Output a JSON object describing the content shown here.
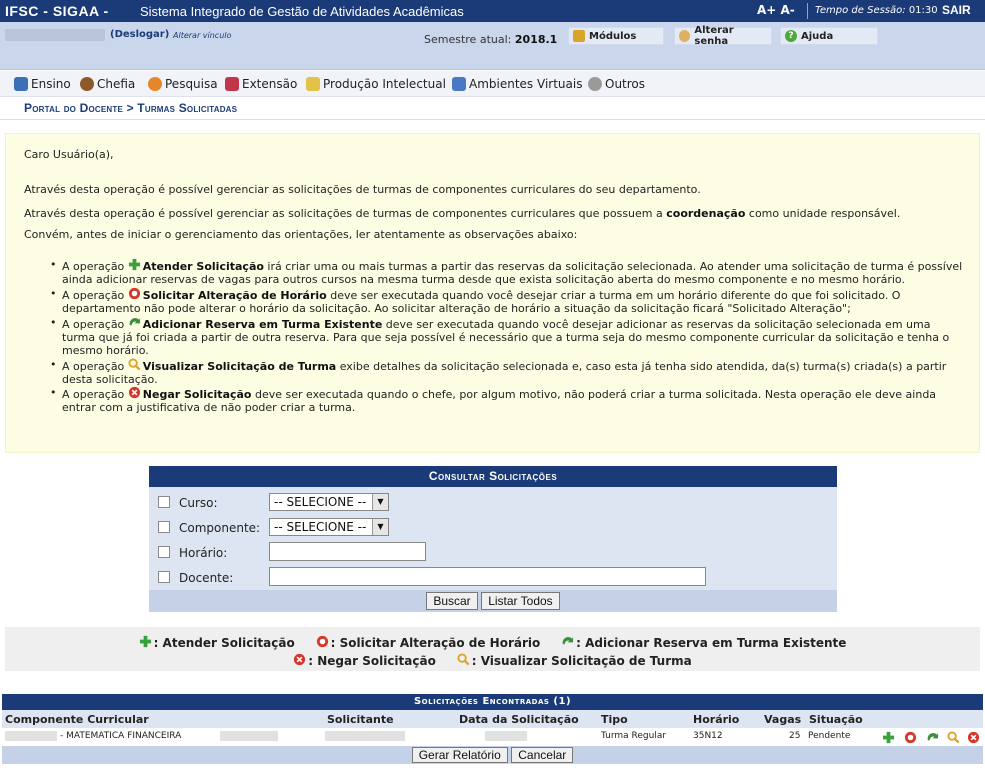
{
  "topbar": {
    "brand": "IFSC - SIGAA -",
    "subtitle": "Sistema Integrado de Gestão de Atividades Acadêmicas",
    "font_controls": "A+ A-",
    "session_label": "Tempo de Sessão:",
    "session_time": "01:30",
    "logout": "SAIR"
  },
  "infobar": {
    "deslogar": "(Deslogar)",
    "alterar_vinculo": "Alterar vínculo",
    "semestre_label": "Semestre atual:",
    "semestre_value": "2018.1",
    "modulos": "Módulos",
    "alterar_senha": "Alterar senha",
    "ajuda": "Ajuda"
  },
  "menu": [
    "Ensino",
    "Chefia",
    "Pesquisa",
    "Extensão",
    "Produção Intelectual",
    "Ambientes Virtuais",
    "Outros"
  ],
  "breadcrumb": "Portal do Docente > Turmas Solicitadas",
  "instructions": {
    "greeting": "Caro Usuário(a),",
    "p1": "Através desta operação é possível gerenciar as solicitações de turmas de componentes curriculares do seu departamento.",
    "p2_pre": "Através desta operação é possível gerenciar as solicitações de turmas de componentes curriculares que possuem a ",
    "p2_bold": "coordenação",
    "p2_post": " como unidade responsável.",
    "p3": "Convém, antes de iniciar o gerenciamento das orientações, ler atentamente as observações abaixo:",
    "items": [
      {
        "pre": "A operação ",
        "op": "Atender Solicitação",
        "text": " irá criar uma ou mais turmas a partir das reservas da solicitação selecionada. Ao atender uma solicitação de turma é possível ainda adicionar reservas de vagas para outros cursos na mesma turma desde que exista solicitação aberta do mesmo componente e no mesmo horário."
      },
      {
        "pre": "A operação ",
        "op": "Solicitar Alteração de Horário",
        "text": " deve ser executada quando você desejar criar a turma em um horário diferente do que foi solicitado. O departamento não pode alterar o horário da solicitação. Ao solicitar alteração de horário a situação da solicitação ficará \"Solicitado Alteração\";"
      },
      {
        "pre": "A operação ",
        "op": "Adicionar Reserva em Turma Existente",
        "text": " deve ser executada quando você desejar adicionar as reservas da solicitação selecionada em uma turma que já foi criada a partir de outra reserva. Para que seja possível é necessário que a turma seja do mesmo componente curricular da solicitação e tenha o mesmo horário."
      },
      {
        "pre": "A operação ",
        "op": "Visualizar Solicitação de Turma",
        "text": " exibe detalhes da solicitação selecionada e, caso esta já tenha sido atendida, da(s) turma(s) criada(s) a partir desta solicitação."
      },
      {
        "pre": "A operação ",
        "op": "Negar Solicitação",
        "text": " deve ser executada quando o chefe, por algum motivo, não poderá criar a turma solicitada. Nesta operação ele deve ainda entrar com a justificativa de não poder criar a turma."
      }
    ]
  },
  "form": {
    "title": "Consultar Solicitações",
    "curso_label": "Curso:",
    "curso_value": "-- SELECIONE --",
    "componente_label": "Componente:",
    "componente_value": "-- SELECIONE --",
    "horario_label": "Horário:",
    "docente_label": "Docente:",
    "buscar": "Buscar",
    "listar": "Listar Todos"
  },
  "legend": {
    "atender": ": Atender Solicitação",
    "alterar": ": Solicitar Alteração de Horário",
    "adicionar": ": Adicionar Reserva em Turma Existente",
    "negar": ": Negar Solicitação",
    "visualizar": ": Visualizar Solicitação de Turma"
  },
  "results": {
    "title": "Solicitações Encontradas (1)",
    "columns": [
      "Componente Curricular",
      "Solicitante",
      "Data da Solicitação",
      "Tipo",
      "Horário",
      "Vagas",
      "Situação"
    ],
    "rows": [
      {
        "componente": "- MATEMATICA FINANCEIRA",
        "tipo": "Turma Regular",
        "horario": "35N12",
        "vagas": "25",
        "situacao": "Pendente"
      }
    ],
    "gerar": "Gerar Relatório",
    "cancelar": "Cancelar"
  },
  "colors": {
    "primary": "#1b3b78",
    "info_bg": "#c9d6ec",
    "instr_bg": "#fdfde3"
  }
}
